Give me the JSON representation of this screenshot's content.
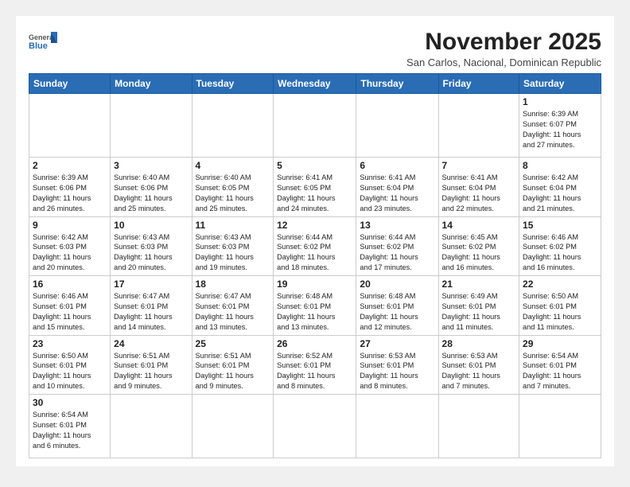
{
  "header": {
    "month_title": "November 2025",
    "subtitle": "San Carlos, Nacional, Dominican Republic",
    "logo_general": "General",
    "logo_blue": "Blue"
  },
  "days_of_week": [
    "Sunday",
    "Monday",
    "Tuesday",
    "Wednesday",
    "Thursday",
    "Friday",
    "Saturday"
  ],
  "weeks": [
    [
      {
        "day": "",
        "info": ""
      },
      {
        "day": "",
        "info": ""
      },
      {
        "day": "",
        "info": ""
      },
      {
        "day": "",
        "info": ""
      },
      {
        "day": "",
        "info": ""
      },
      {
        "day": "",
        "info": ""
      },
      {
        "day": "1",
        "info": "Sunrise: 6:39 AM\nSunset: 6:07 PM\nDaylight: 11 hours\nand 27 minutes."
      }
    ],
    [
      {
        "day": "2",
        "info": "Sunrise: 6:39 AM\nSunset: 6:06 PM\nDaylight: 11 hours\nand 26 minutes."
      },
      {
        "day": "3",
        "info": "Sunrise: 6:40 AM\nSunset: 6:06 PM\nDaylight: 11 hours\nand 25 minutes."
      },
      {
        "day": "4",
        "info": "Sunrise: 6:40 AM\nSunset: 6:05 PM\nDaylight: 11 hours\nand 25 minutes."
      },
      {
        "day": "5",
        "info": "Sunrise: 6:41 AM\nSunset: 6:05 PM\nDaylight: 11 hours\nand 24 minutes."
      },
      {
        "day": "6",
        "info": "Sunrise: 6:41 AM\nSunset: 6:04 PM\nDaylight: 11 hours\nand 23 minutes."
      },
      {
        "day": "7",
        "info": "Sunrise: 6:41 AM\nSunset: 6:04 PM\nDaylight: 11 hours\nand 22 minutes."
      },
      {
        "day": "8",
        "info": "Sunrise: 6:42 AM\nSunset: 6:04 PM\nDaylight: 11 hours\nand 21 minutes."
      }
    ],
    [
      {
        "day": "9",
        "info": "Sunrise: 6:42 AM\nSunset: 6:03 PM\nDaylight: 11 hours\nand 20 minutes."
      },
      {
        "day": "10",
        "info": "Sunrise: 6:43 AM\nSunset: 6:03 PM\nDaylight: 11 hours\nand 20 minutes."
      },
      {
        "day": "11",
        "info": "Sunrise: 6:43 AM\nSunset: 6:03 PM\nDaylight: 11 hours\nand 19 minutes."
      },
      {
        "day": "12",
        "info": "Sunrise: 6:44 AM\nSunset: 6:02 PM\nDaylight: 11 hours\nand 18 minutes."
      },
      {
        "day": "13",
        "info": "Sunrise: 6:44 AM\nSunset: 6:02 PM\nDaylight: 11 hours\nand 17 minutes."
      },
      {
        "day": "14",
        "info": "Sunrise: 6:45 AM\nSunset: 6:02 PM\nDaylight: 11 hours\nand 16 minutes."
      },
      {
        "day": "15",
        "info": "Sunrise: 6:46 AM\nSunset: 6:02 PM\nDaylight: 11 hours\nand 16 minutes."
      }
    ],
    [
      {
        "day": "16",
        "info": "Sunrise: 6:46 AM\nSunset: 6:01 PM\nDaylight: 11 hours\nand 15 minutes."
      },
      {
        "day": "17",
        "info": "Sunrise: 6:47 AM\nSunset: 6:01 PM\nDaylight: 11 hours\nand 14 minutes."
      },
      {
        "day": "18",
        "info": "Sunrise: 6:47 AM\nSunset: 6:01 PM\nDaylight: 11 hours\nand 13 minutes."
      },
      {
        "day": "19",
        "info": "Sunrise: 6:48 AM\nSunset: 6:01 PM\nDaylight: 11 hours\nand 13 minutes."
      },
      {
        "day": "20",
        "info": "Sunrise: 6:48 AM\nSunset: 6:01 PM\nDaylight: 11 hours\nand 12 minutes."
      },
      {
        "day": "21",
        "info": "Sunrise: 6:49 AM\nSunset: 6:01 PM\nDaylight: 11 hours\nand 11 minutes."
      },
      {
        "day": "22",
        "info": "Sunrise: 6:50 AM\nSunset: 6:01 PM\nDaylight: 11 hours\nand 11 minutes."
      }
    ],
    [
      {
        "day": "23",
        "info": "Sunrise: 6:50 AM\nSunset: 6:01 PM\nDaylight: 11 hours\nand 10 minutes."
      },
      {
        "day": "24",
        "info": "Sunrise: 6:51 AM\nSunset: 6:01 PM\nDaylight: 11 hours\nand 9 minutes."
      },
      {
        "day": "25",
        "info": "Sunrise: 6:51 AM\nSunset: 6:01 PM\nDaylight: 11 hours\nand 9 minutes."
      },
      {
        "day": "26",
        "info": "Sunrise: 6:52 AM\nSunset: 6:01 PM\nDaylight: 11 hours\nand 8 minutes."
      },
      {
        "day": "27",
        "info": "Sunrise: 6:53 AM\nSunset: 6:01 PM\nDaylight: 11 hours\nand 8 minutes."
      },
      {
        "day": "28",
        "info": "Sunrise: 6:53 AM\nSunset: 6:01 PM\nDaylight: 11 hours\nand 7 minutes."
      },
      {
        "day": "29",
        "info": "Sunrise: 6:54 AM\nSunset: 6:01 PM\nDaylight: 11 hours\nand 7 minutes."
      }
    ],
    [
      {
        "day": "30",
        "info": "Sunrise: 6:54 AM\nSunset: 6:01 PM\nDaylight: 11 hours\nand 6 minutes."
      },
      {
        "day": "",
        "info": ""
      },
      {
        "day": "",
        "info": ""
      },
      {
        "day": "",
        "info": ""
      },
      {
        "day": "",
        "info": ""
      },
      {
        "day": "",
        "info": ""
      },
      {
        "day": "",
        "info": ""
      }
    ]
  ]
}
